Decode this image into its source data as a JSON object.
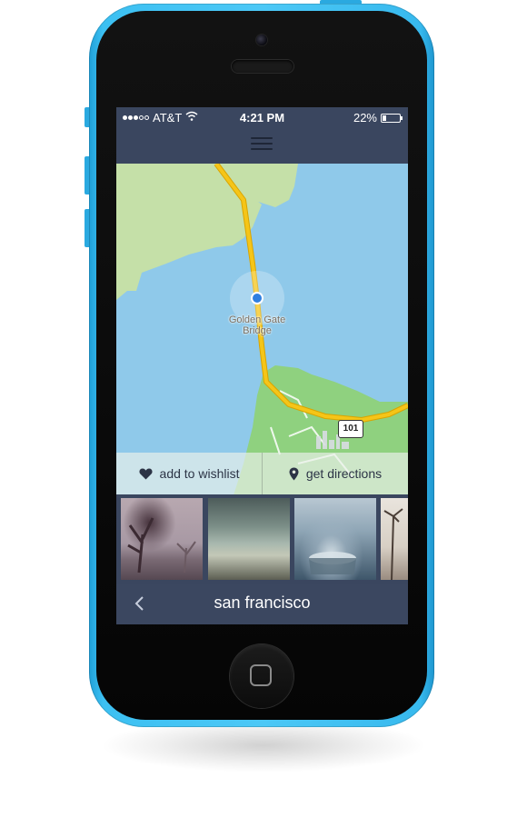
{
  "status_bar": {
    "carrier": "AT&T",
    "time": "4:21 PM",
    "battery_percent": "22%",
    "battery_level": 0.22,
    "signal_bars_filled": 3,
    "signal_bars_total": 5
  },
  "top_nav": {
    "menu_icon": "hamburger-icon"
  },
  "map": {
    "place_label_line1": "Golden Gate",
    "place_label_line2": "Bridge",
    "route_shield": "101"
  },
  "actions": {
    "wishlist_label": "add to wishlist",
    "wishlist_icon": "heart-icon",
    "directions_label": "get directions",
    "directions_icon": "location-pin-icon"
  },
  "photos": [
    {
      "name": "foggy-trees-photo"
    },
    {
      "name": "cloudy-sky-photo"
    },
    {
      "name": "coffee-cup-photo"
    },
    {
      "name": "palm-trees-photo"
    }
  ],
  "bottom_bar": {
    "title": "san francisco",
    "back_icon": "chevron-left-icon"
  },
  "colors": {
    "phone": "#3cc0f2",
    "nav_bar": "#3a465f",
    "water": "#8fc9ea",
    "land": "#c5e0a8",
    "park": "#8fd17f",
    "road": "#f5c518"
  }
}
